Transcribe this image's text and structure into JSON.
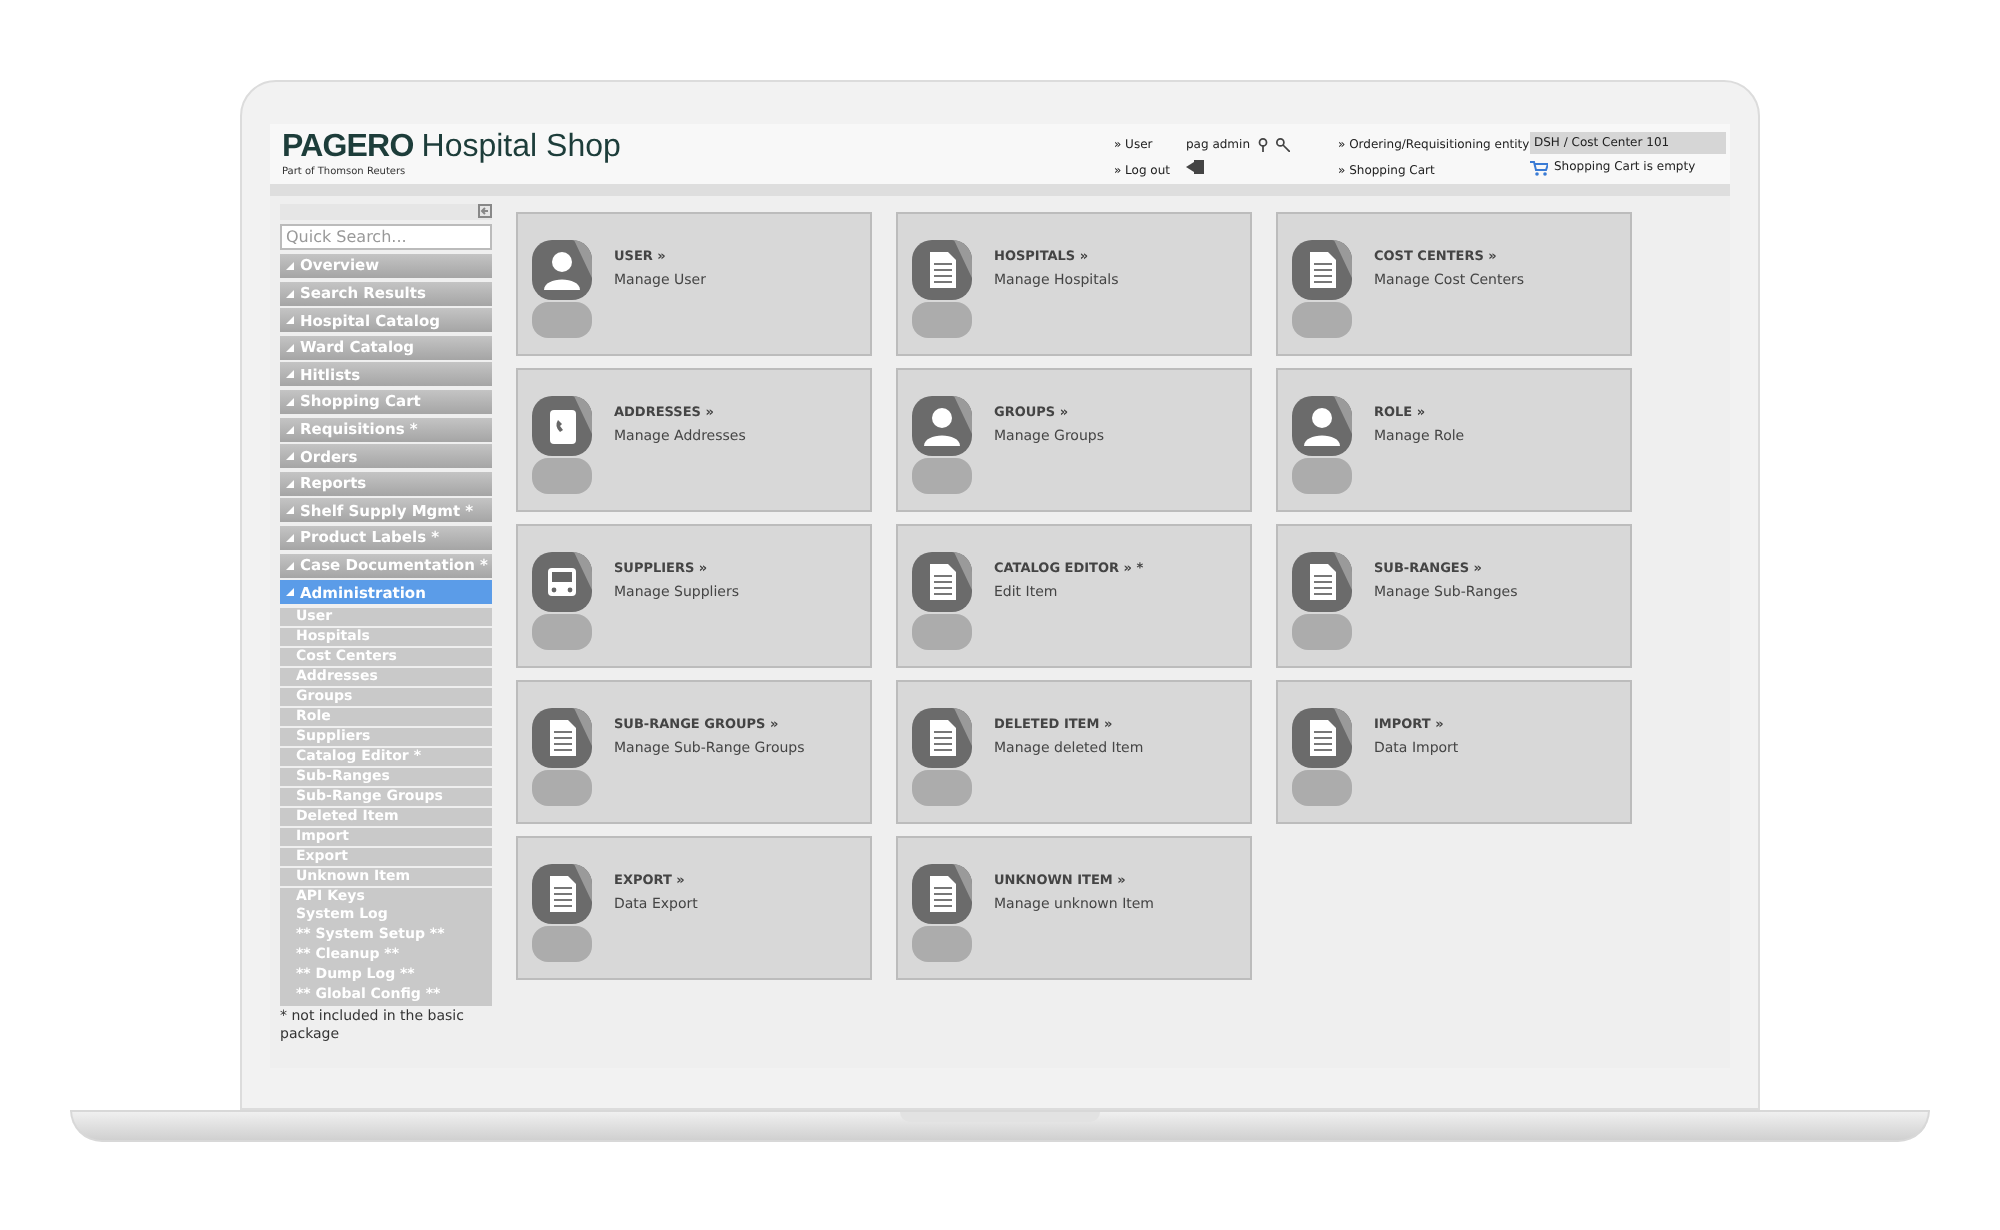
{
  "header": {
    "brand": "PAGERO",
    "product": "Hospital Shop",
    "tagline": "Part of Thomson Reuters",
    "user_link": "» User",
    "logout_link": "» Log out",
    "username": "pag admin",
    "entity_link": "» Ordering/Requisitioning entity",
    "cart_link": "» Shopping Cart",
    "entity_value": "DSH / Cost Center 101",
    "cart_status": "Shopping Cart is empty"
  },
  "sidebar": {
    "search": {
      "placeholder": "Quick Search..."
    },
    "menu": [
      {
        "label": "Overview",
        "selected": false
      },
      {
        "label": "Search Results",
        "selected": false
      },
      {
        "label": "Hospital Catalog",
        "selected": false
      },
      {
        "label": "Ward Catalog",
        "selected": false
      },
      {
        "label": "Hitlists",
        "selected": false
      },
      {
        "label": "Shopping Cart",
        "selected": false
      },
      {
        "label": "Requisitions *",
        "selected": false
      },
      {
        "label": "Orders",
        "selected": false
      },
      {
        "label": "Reports",
        "selected": false
      },
      {
        "label": "Shelf Supply Mgmt *",
        "selected": false
      },
      {
        "label": "Product Labels *",
        "selected": false
      },
      {
        "label": "Case Documentation *",
        "selected": false
      },
      {
        "label": "Administration",
        "selected": true,
        "children": [
          {
            "label": "User"
          },
          {
            "label": "Hospitals"
          },
          {
            "label": "Cost Centers"
          },
          {
            "label": "Addresses"
          },
          {
            "label": "Groups"
          },
          {
            "label": "Role"
          },
          {
            "label": "Suppliers"
          },
          {
            "label": "Catalog Editor *"
          },
          {
            "label": "Sub-Ranges"
          },
          {
            "label": "Sub-Range Groups"
          },
          {
            "label": "Deleted Item"
          },
          {
            "label": "Import"
          },
          {
            "label": "Export"
          },
          {
            "label": "Unknown Item"
          },
          {
            "label": "API Keys"
          },
          {
            "label": "System Log"
          },
          {
            "label": "** System Setup **"
          },
          {
            "label": "** Cleanup **"
          },
          {
            "label": "** Dump Log **"
          },
          {
            "label": "** Global Config **"
          }
        ]
      }
    ],
    "footnote": "* not included in the basic package"
  },
  "tiles": [
    {
      "title": "USER »",
      "subtitle": "Manage User"
    },
    {
      "title": "HOSPITALS »",
      "subtitle": "Manage Hospitals"
    },
    {
      "title": "COST CENTERS »",
      "subtitle": "Manage Cost Centers"
    },
    {
      "title": "ADDRESSES »",
      "subtitle": "Manage Addresses"
    },
    {
      "title": "GROUPS »",
      "subtitle": "Manage Groups"
    },
    {
      "title": "ROLE »",
      "subtitle": "Manage Role"
    },
    {
      "title": "SUPPLIERS »",
      "subtitle": "Manage Suppliers"
    },
    {
      "title": "CATALOG EDITOR » *",
      "subtitle": "Edit Item"
    },
    {
      "title": "SUB-RANGES »",
      "subtitle": "Manage Sub-Ranges"
    },
    {
      "title": "SUB-RANGE GROUPS »",
      "subtitle": "Manage Sub-Range Groups"
    },
    {
      "title": "DELETED ITEM »",
      "subtitle": "Manage deleted Item"
    },
    {
      "title": "IMPORT »",
      "subtitle": "Data Import"
    },
    {
      "title": "EXPORT »",
      "subtitle": "Data Export"
    },
    {
      "title": "UNKNOWN ITEM »",
      "subtitle": "Manage unknown Item"
    }
  ]
}
